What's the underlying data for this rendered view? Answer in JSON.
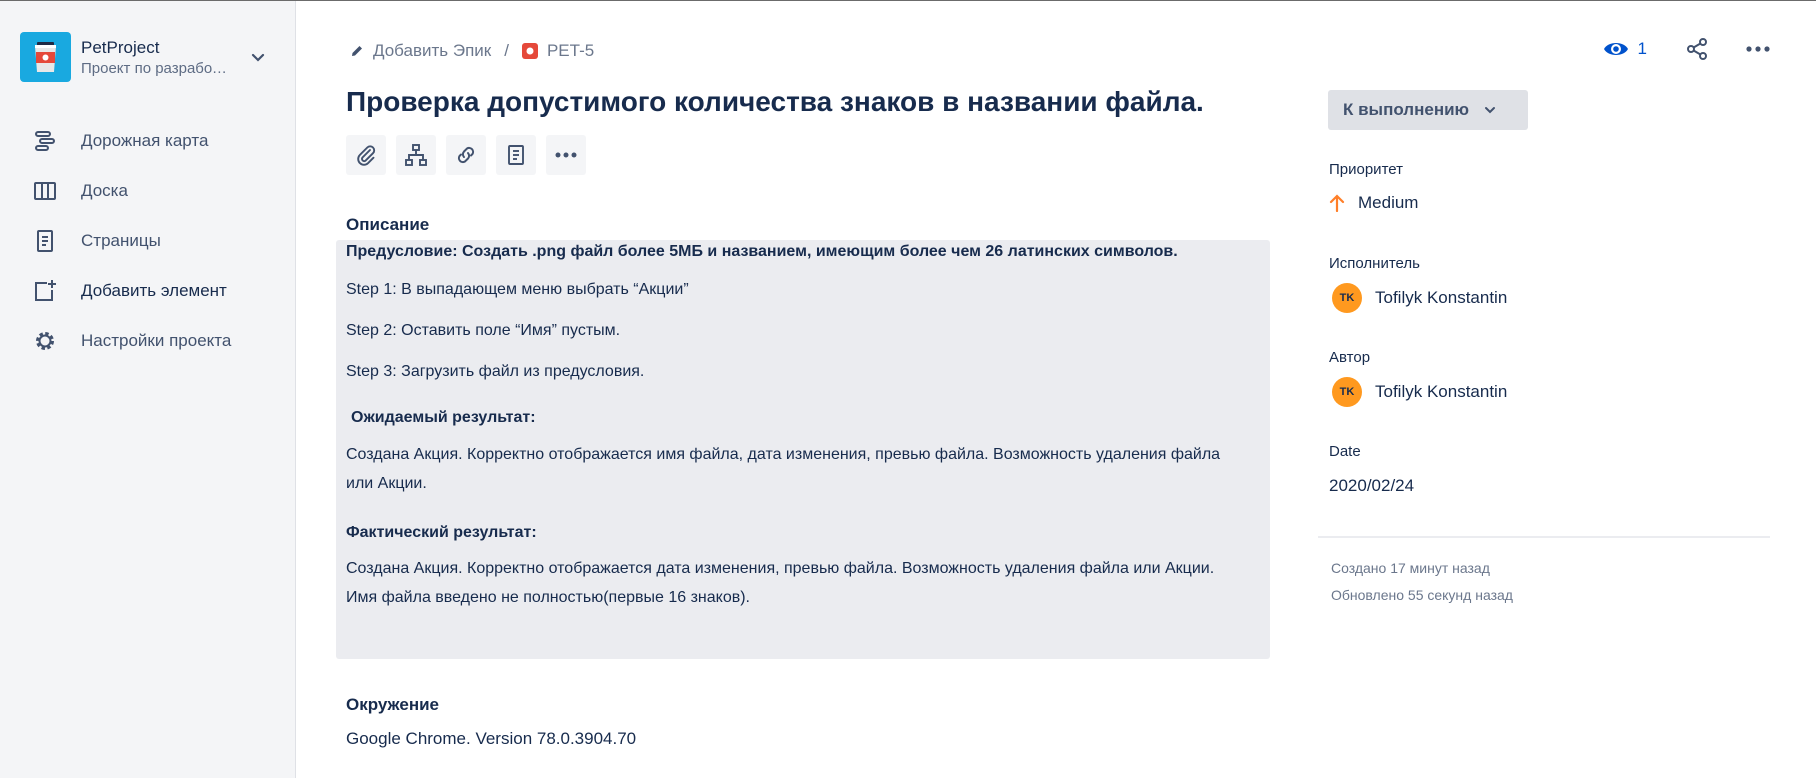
{
  "project": {
    "name": "PetProject",
    "subtitle": "Проект по разработке ПО"
  },
  "sidebar": {
    "items": [
      {
        "label": "Дорожная карта",
        "icon": "roadmap-icon"
      },
      {
        "label": "Доска",
        "icon": "board-icon"
      },
      {
        "label": "Страницы",
        "icon": "pages-icon"
      },
      {
        "label": "Добавить элемент",
        "icon": "add-item-icon"
      },
      {
        "label": "Настройки проекта",
        "icon": "gear-icon"
      }
    ]
  },
  "breadcrumbs": {
    "epic": "Добавить Эпик",
    "separator": "/",
    "issue_key": "PET-5"
  },
  "watchers": {
    "count": "1"
  },
  "issue": {
    "title": "Проверка допустимого количества знаков в названии файла.",
    "description_heading": "Описание",
    "description": {
      "precondition": "Предусловие: Создать .png файл более 5МБ и названием, имеющим более чем 26 латинских символов.",
      "step1": "Step 1: В выпадающем меню выбрать “Акции”",
      "step2": "Step 2: Оставить поле “Имя” пустым.",
      "step3": "Step 3: Загрузить файл из предусловия.",
      "expected_heading": "Ожидаемый результат:",
      "expected": "Создана Акция. Корректно отображается имя файла, дата изменения, превью файла. Возможность удаления файла или Акции.",
      "actual_heading": "Фактический результат:",
      "actual": "Создана Акция. Корректно отображается дата изменения, превью файла. Возможность удаления файла или Акции. Имя файла введено не полностью(первые 16 знаков)."
    },
    "environment_heading": "Окружение",
    "environment": "Google Chrome. Version 78.0.3904.70"
  },
  "panel": {
    "status": "К выполнению",
    "priority_label": "Приоритет",
    "priority": "Medium",
    "assignee_label": "Исполнитель",
    "assignee": "Tofilyk Konstantin",
    "assignee_initials": "TK",
    "reporter_label": "Автор",
    "reporter": "Tofilyk Konstantin",
    "reporter_initials": "TK",
    "date_label": "Date",
    "date": "2020/02/24",
    "created": "Создано 17 минут назад",
    "updated": "Обновлено 55 секунд назад"
  },
  "colors": {
    "accent": "#0052cc",
    "priority": "#ff7f29",
    "avatar": "#ff991f",
    "issue_type": "#e5493a",
    "project_logo": "#19a9e0"
  }
}
